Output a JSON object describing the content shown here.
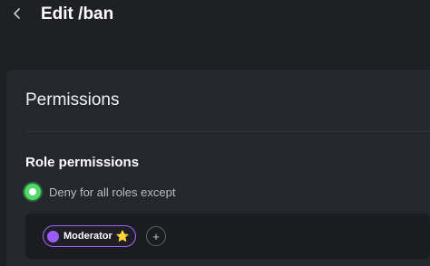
{
  "header": {
    "title": "Edit /ban",
    "back_icon": "chevron-left-icon"
  },
  "permissions": {
    "heading": "Permissions",
    "role_permissions_title": "Role permissions",
    "deny_option": {
      "label": "Deny for all roles except",
      "selected": true,
      "color": "#54d86b"
    },
    "roles": [
      {
        "name": "Moderator",
        "emoji": "⭐",
        "color": "#9b5cf6"
      }
    ],
    "add_role_symbol": "+"
  },
  "colors": {
    "accent_green": "#54d86b",
    "role_purple": "#9b5cf6",
    "background": "#1d1f23"
  }
}
